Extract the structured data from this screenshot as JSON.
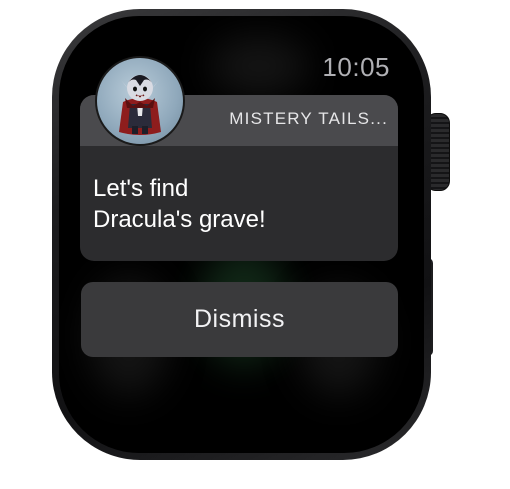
{
  "status": {
    "time": "10:05"
  },
  "notification": {
    "app_name": "MISTERY TAILS...",
    "app_icon": "vampire-dracula-icon",
    "message_line1": "Let's find",
    "message_line2": "Dracula's grave!"
  },
  "actions": {
    "dismiss_label": "Dismiss"
  },
  "colors": {
    "screen_bg": "#000000",
    "card_bg": "#2c2c2e",
    "card_header_bg": "#4a4a4d",
    "button_bg": "#3a3a3c",
    "time_text": "#b0b0b4"
  }
}
